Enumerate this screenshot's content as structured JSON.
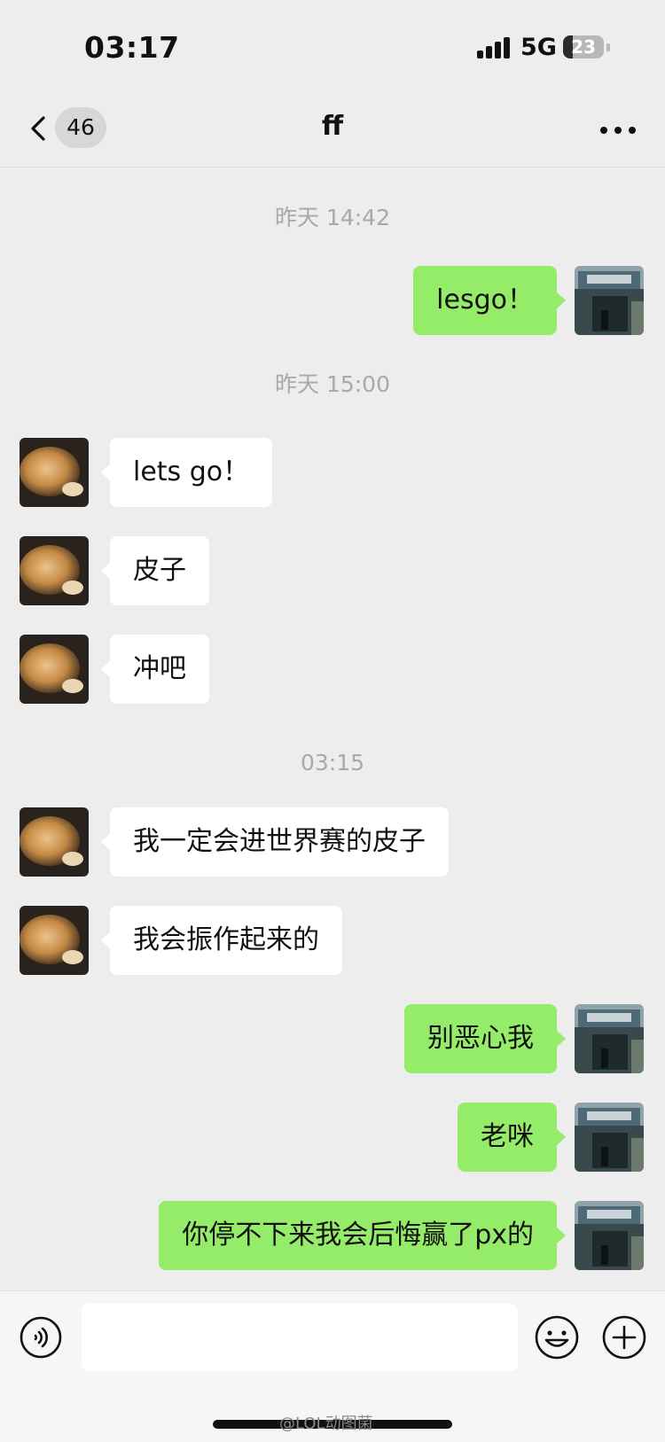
{
  "status_bar": {
    "time": "03:17",
    "network": "5G",
    "battery": "23",
    "battery_level": 0.23
  },
  "header": {
    "unread_count": "46",
    "title": "ff"
  },
  "messages": [
    {
      "timestamp": "昨天 14:42"
    },
    {
      "from": "me",
      "text": "lesgo！"
    },
    {
      "timestamp": "昨天 15:00"
    },
    {
      "from": "other",
      "text": "lets go！"
    },
    {
      "from": "other",
      "text": "皮子"
    },
    {
      "from": "other",
      "text": "冲吧"
    },
    {
      "timestamp": "03:15"
    },
    {
      "from": "other",
      "text": "我一定会进世界赛的皮子"
    },
    {
      "from": "other",
      "text": "我会振作起来的"
    },
    {
      "from": "me",
      "text": "别恶心我"
    },
    {
      "from": "me",
      "text": "老咪"
    },
    {
      "from": "me",
      "text": "你停不下来我会后悔赢了px的"
    }
  ],
  "input_bar": {
    "placeholder": ""
  },
  "watermark": "@LOL动图菌",
  "icons": {
    "back": "chevron-left-icon",
    "more": "more-dots-icon",
    "voice": "voice-icon",
    "emoji": "emoji-icon",
    "plus": "plus-icon"
  },
  "colors": {
    "background": "#ededed",
    "bubble_out": "#95ec69",
    "bubble_in": "#ffffff"
  }
}
